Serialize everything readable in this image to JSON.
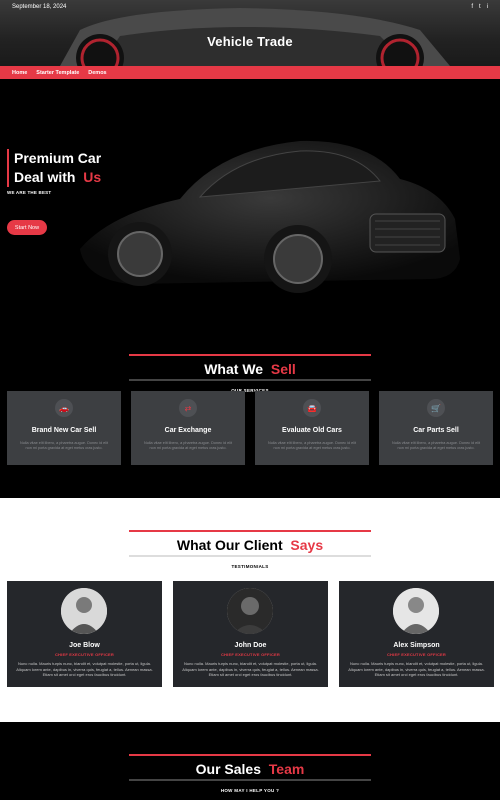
{
  "header": {
    "date": "September 18, 2024",
    "site_title": "Vehicle Trade",
    "socials": [
      "f",
      "t",
      "i"
    ]
  },
  "nav": {
    "items": [
      "Home",
      "Starter Template",
      "Demos"
    ]
  },
  "hero": {
    "title_line1": "Premium Car",
    "title_line2": "Deal with",
    "title_accent": "Us",
    "subtitle": "WE ARE THE BEST",
    "button_label": "Start Now"
  },
  "services": {
    "title": "What We",
    "title_accent": "Sell",
    "subtitle": "OUR SERVICES",
    "cards": [
      {
        "name": "Brand New Car Sell",
        "icon": "car-icon",
        "desc": "Nulla vitae elit libero, a pharetra augue. Donec id elit non mi porta gravida at eget metus cras justo."
      },
      {
        "name": "Car Exchange",
        "icon": "exchange-icon",
        "desc": "Nulla vitae elit libero, a pharetra augue. Donec id elit non mi porta gravida at eget metus cras justo."
      },
      {
        "name": "Evaluate Old Cars",
        "icon": "car-front-icon",
        "desc": "Nulla vitae elit libero, a pharetra augue. Donec id elit non mi porta gravida at eget metus cras justo."
      },
      {
        "name": "Car Parts Sell",
        "icon": "cart-icon",
        "desc": "Nulla vitae elit libero, a pharetra augue. Donec id elit non mi porta gravida at eget metus cras justo."
      }
    ]
  },
  "testimonials": {
    "title": "What Our Client",
    "title_accent": "Says",
    "subtitle": "TESTIMONIALS",
    "items": [
      {
        "name": "Joe Blow",
        "role": "CHIEF EXECUTIVE OFFICER",
        "text": "Nunc nulla. Mauris turpis nunc, blandit et, volutpat molestie, porta ut, ligula. Aliquam lorem ante, dapibus in, viverra quis, feugiat a, tellus. Aenean massa. Etiam sit amet orci eget eros faucibus tincidunt."
      },
      {
        "name": "John Doe",
        "role": "CHIEF EXECUTIVE OFFICER",
        "text": "Nunc nulla. Mauris turpis nunc, blandit et, volutpat molestie, porta ut, ligula. Aliquam lorem ante, dapibus in, viverra quis, feugiat a, tellus. Aenean massa. Etiam sit amet orci eget eros faucibus tincidunt."
      },
      {
        "name": "Alex Simpson",
        "role": "CHIEF EXECUTIVE OFFICER",
        "text": "Nunc nulla. Mauris turpis nunc, blandit et, volutpat molestie, porta ut, ligula. Aliquam lorem ante, dapibus in, viverra quis, feugiat a, tellus. Aenean massa. Etiam sit amet orci eget eros faucibus tincidunt."
      }
    ]
  },
  "team": {
    "title": "Our Sales",
    "title_accent": "Team",
    "subtitle": "HOW MAY I HELP YOU ?"
  },
  "colors": {
    "accent": "#e63946",
    "dark": "#000000",
    "card": "#3d3f42"
  }
}
